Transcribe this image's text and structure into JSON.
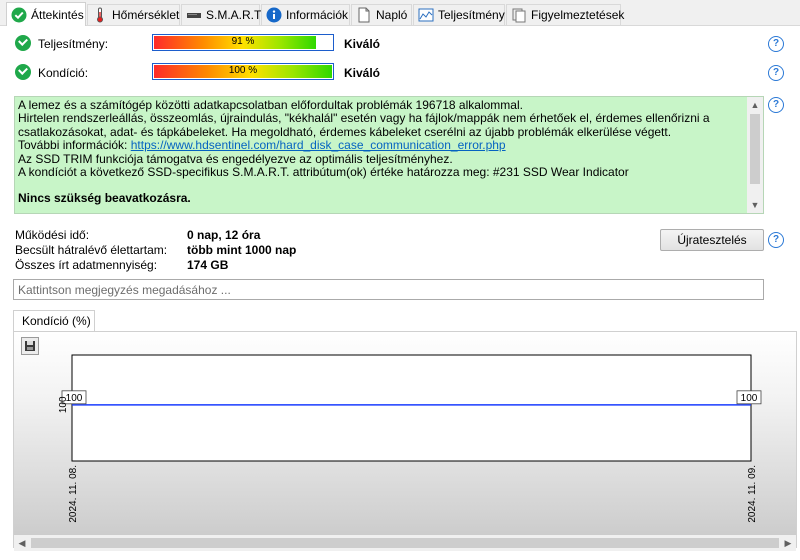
{
  "tabs": [
    {
      "label": "Áttekintés",
      "icon": "check-circle-icon",
      "active": true
    },
    {
      "label": "Hőmérséklet",
      "icon": "thermometer-icon",
      "active": false
    },
    {
      "label": "S.M.A.R.T.",
      "icon": "drive-icon",
      "active": false
    },
    {
      "label": "Információk",
      "icon": "info-icon",
      "active": false
    },
    {
      "label": "Napló",
      "icon": "document-icon",
      "active": false
    },
    {
      "label": "Teljesítmény",
      "icon": "performance-chart-icon",
      "active": false
    },
    {
      "label": "Figyelmeztetések",
      "icon": "alerts-icon",
      "active": false
    }
  ],
  "performance": {
    "label": "Teljesítmény:",
    "percent": 91,
    "percent_text": "91 %",
    "rating": "Kiváló"
  },
  "health": {
    "label": "Kondíció:",
    "percent": 100,
    "percent_text": "100 %",
    "rating": "Kiváló"
  },
  "message": {
    "lines": [
      "A lemez és a számítógép közötti adatkapcsolatban előfordultak problémák 196718 alkalommal.",
      "Hirtelen rendszerleállás, összeomlás, újraindulás, \"kékhalál\" esetén vagy ha fájlok/mappák nem érhetőek el, érdemes ellenőrizni a",
      "csatlakozásokat, adat- és tápkábeleket. Ha megoldható, érdemes kábeleket cserélni az újabb problémák elkerülése végett."
    ],
    "more_info_label": "További információk:",
    "more_info_link": "https://www.hdsentinel.com/hard_disk_case_communication_error.php",
    "trim_line": "Az SSD TRIM funkciója támogatva és engedélyezve az optimális teljesítményhez.",
    "smart_line": "A kondíciót a következő SSD-specifikus S.M.A.R.T. attribútum(ok) értéke határozza meg:  #231 SSD Wear Indicator",
    "conclusion": "Nincs szükség beavatkozásra."
  },
  "stats": [
    {
      "label": "Működési idő:",
      "value": "0 nap, 12 óra"
    },
    {
      "label": "Becsült hátralévő élettartam:",
      "value": "több mint 1000 nap"
    },
    {
      "label": "Összes írt adatmennyiség:",
      "value": "174 GB"
    }
  ],
  "retest_button": "Újratesztelés",
  "note_placeholder": "Kattintson megjegyzés megadásához ...",
  "chart_tab": "Kondíció  (%)",
  "colors": {
    "check": "#1fa84a",
    "message_bg": "#c8f5c8",
    "series": "#1a3cff",
    "link": "#0563c1"
  },
  "chart_data": {
    "type": "line",
    "categories": [
      "2024. 11. 08.",
      "2024. 11. 09."
    ],
    "values": [
      100,
      100
    ],
    "y_tick_labels": [
      "100"
    ],
    "ylim": [
      0,
      100
    ],
    "grid": false
  }
}
